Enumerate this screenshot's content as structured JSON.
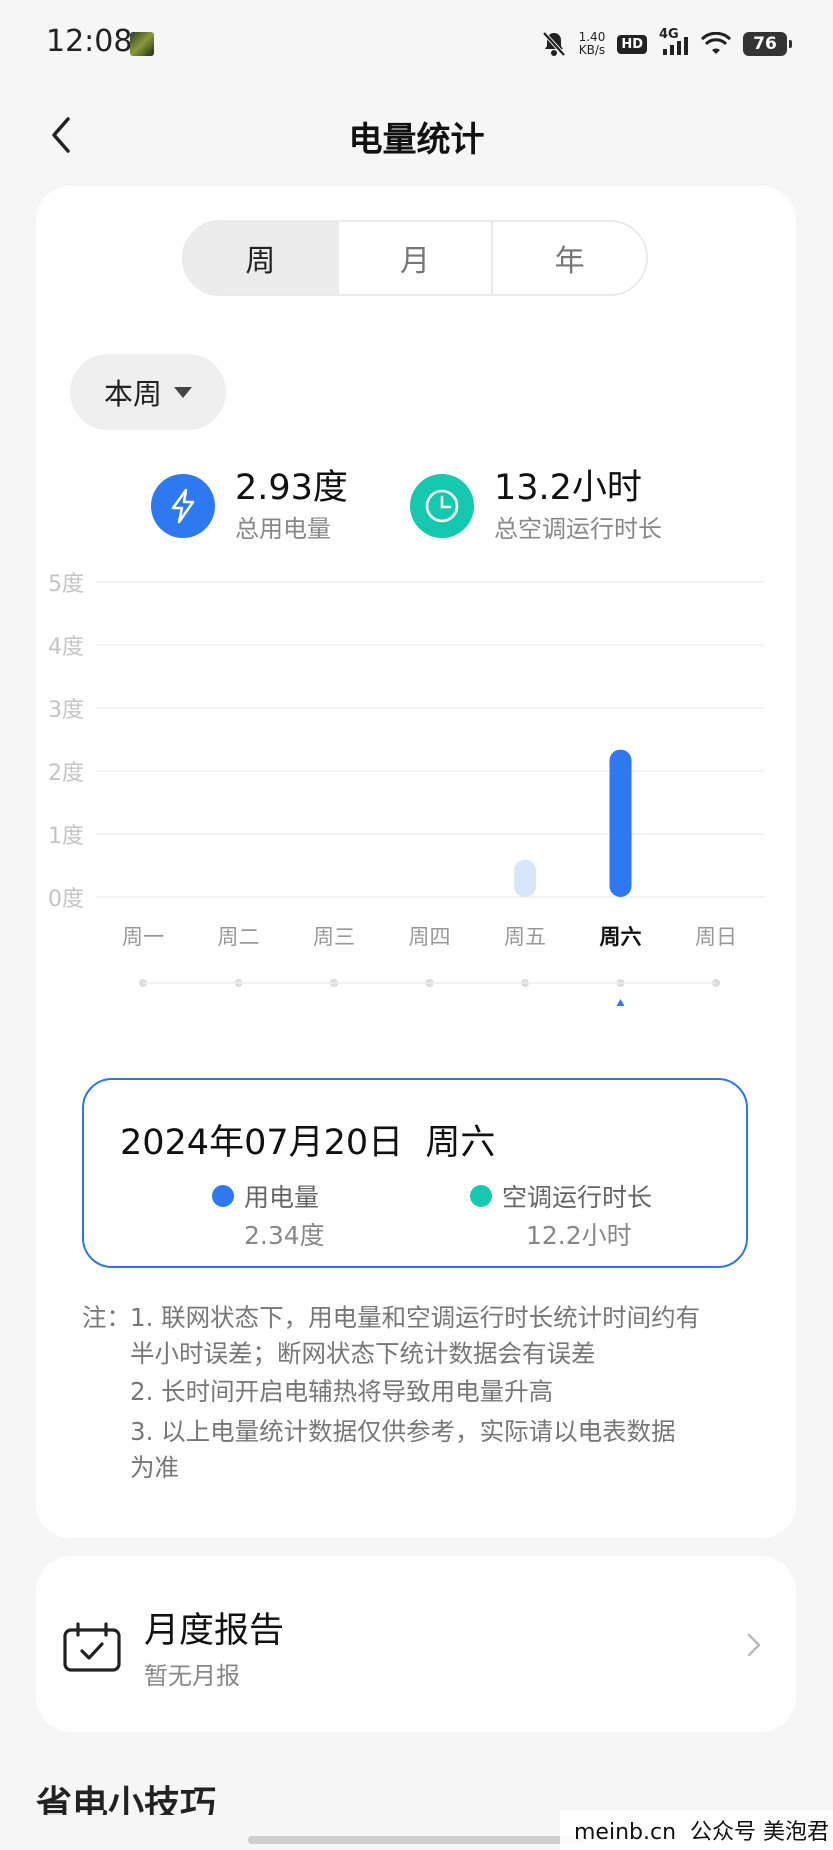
{
  "status_bar": {
    "time": "12:08",
    "net_speed_value": "1.40",
    "net_speed_unit": "KB/s",
    "hd_badge": "HD",
    "network_type": "4G",
    "battery_level": "76"
  },
  "header": {
    "title": "电量统计"
  },
  "period_tabs": [
    {
      "label": "周",
      "active": true
    },
    {
      "label": "月",
      "active": false
    },
    {
      "label": "年",
      "active": false
    }
  ],
  "period_dropdown": {
    "value": "本周"
  },
  "summary": {
    "total_energy": {
      "value": "2.93度",
      "label": "总用电量",
      "icon": "lightning-icon",
      "color": "#2e78f0"
    },
    "total_runtime": {
      "value": "13.2小时",
      "label": "总空调运行时长",
      "icon": "clock-icon",
      "color": "#17c8b0"
    }
  },
  "chart_data": {
    "type": "bar",
    "title": "",
    "xlabel": "",
    "ylabel": "",
    "unit": "度",
    "ylim": [
      0,
      5
    ],
    "y_ticks": [
      "0度",
      "1度",
      "2度",
      "3度",
      "4度",
      "5度"
    ],
    "categories": [
      "周一",
      "周二",
      "周三",
      "周四",
      "周五",
      "周六",
      "周日"
    ],
    "values": [
      0,
      0,
      0,
      0,
      0.59,
      2.34,
      0
    ],
    "selected_index": 5,
    "grid": true,
    "bar_color": "#2e78f0",
    "bar_color_inactive": "#d8e6fb"
  },
  "detail": {
    "date": "2024年07月20日",
    "weekday": "周六",
    "energy_label": "用电量",
    "energy_value": "2.34度",
    "energy_color": "#2e78f0",
    "runtime_label": "空调运行时长",
    "runtime_value": "12.2小时",
    "runtime_color": "#17c8b0"
  },
  "notes": {
    "prefix": "注：",
    "items": [
      {
        "line1": "1. 联网状态下，用电量和空调运行时长统计时间约有",
        "line2": "半小时误差；断网状态下统计数据会有误差"
      },
      {
        "line1": "2. 长时间开启电辅热将导致用电量升高"
      },
      {
        "line1": "3. 以上电量统计数据仅供参考，实际请以电表数据",
        "line2": "为准"
      }
    ]
  },
  "monthly_report": {
    "title": "月度报告",
    "subtitle": "暂无月报",
    "icon": "calendar-check-icon"
  },
  "tips_section": {
    "title": "省电小技巧"
  },
  "watermark": "meinb.cn  公众号 美泡君"
}
